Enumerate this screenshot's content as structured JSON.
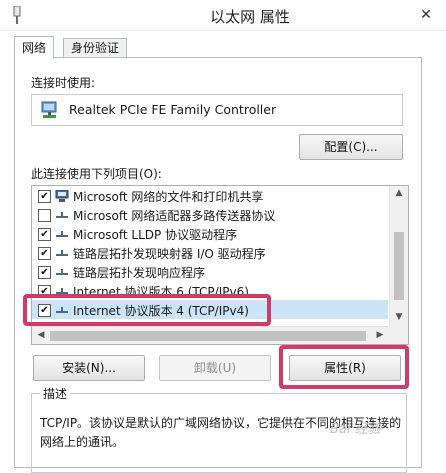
{
  "window": {
    "title": "以太网 属性",
    "close_glyph": "✕"
  },
  "tabs": [
    {
      "label": "网络"
    },
    {
      "label": "身份验证"
    }
  ],
  "connect_using": {
    "label": "连接时使用:",
    "adapter": "Realtek PCIe FE Family Controller",
    "configure_button": "配置(C)..."
  },
  "items_section": {
    "label": "此连接使用下列项目(O):",
    "items": [
      {
        "label": "Microsoft 网络的文件和打印机共享",
        "checked": true,
        "icon": "printer-network-icon"
      },
      {
        "label": "Microsoft 网络适配器多路传送器协议",
        "checked": false,
        "icon": "protocol-icon"
      },
      {
        "label": "Microsoft LLDP 协议驱动程序",
        "checked": true,
        "icon": "protocol-icon"
      },
      {
        "label": "链路层拓扑发现映射器 I/O 驱动程序",
        "checked": true,
        "icon": "protocol-icon"
      },
      {
        "label": "链路层拓扑发现响应程序",
        "checked": true,
        "icon": "protocol-icon"
      },
      {
        "label": "Internet 协议版本 6 (TCP/IPv6)",
        "checked": true,
        "icon": "protocol-icon"
      },
      {
        "label": "Internet 协议版本 4 (TCP/IPv4)",
        "checked": true,
        "icon": "protocol-icon"
      }
    ],
    "check_glyph": "✔"
  },
  "buttons": {
    "install": "安装(N)...",
    "uninstall": "卸载(U)",
    "properties": "属性(R)"
  },
  "description": {
    "title": "描述",
    "text": "TCP/IP。该协议是默认的广域网络协议，它提供在不同的相互连接的网络上的通讯。"
  },
  "watermark": "Bai 经验",
  "colors": {
    "highlight": "#d23a68",
    "selection": "#cce4f7"
  }
}
